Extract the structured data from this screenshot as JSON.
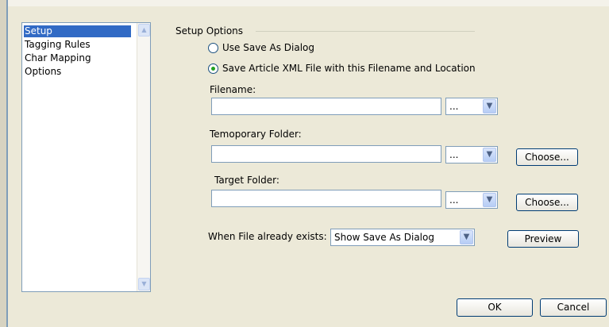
{
  "sidebar": {
    "items": [
      {
        "label": "Setup",
        "selected": true
      },
      {
        "label": "Tagging Rules",
        "selected": false
      },
      {
        "label": "Char Mapping",
        "selected": false
      },
      {
        "label": "Options",
        "selected": false
      }
    ]
  },
  "setup_options": {
    "group_label": "Setup Options",
    "radio_save_as_dialog": {
      "label": "Use Save As Dialog",
      "checked": false
    },
    "radio_save_article": {
      "label": "Save Article XML File with this Filename and Location",
      "checked": true
    },
    "filename": {
      "label": "Filename:",
      "value": "",
      "dropdown_value": "..."
    },
    "temporary_folder": {
      "label": "Temoporary Folder:",
      "value": "",
      "dropdown_value": "...",
      "choose_label": "Choose..."
    },
    "target_folder": {
      "label": "Target Folder:",
      "value": "",
      "dropdown_value": "...",
      "choose_label": "Choose..."
    },
    "file_exists": {
      "label": "When File already exists:",
      "value": "Show Save As Dialog",
      "preview_label": "Preview"
    }
  },
  "footer": {
    "ok_label": "OK",
    "cancel_label": "Cancel"
  },
  "colors": {
    "selection": "#316ac5",
    "background": "#ece9d8",
    "radio_dot": "#21a121"
  }
}
